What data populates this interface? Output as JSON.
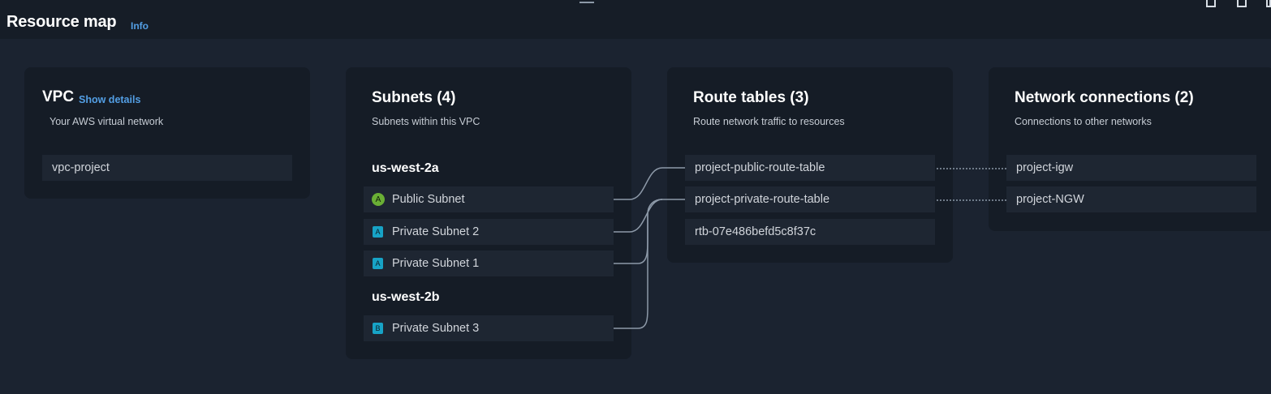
{
  "header": {
    "title": "Resource map",
    "info_label": "Info"
  },
  "vpc": {
    "title": "VPC",
    "show_details_label": "Show details",
    "subtitle": "Your AWS virtual network",
    "item": "vpc-project"
  },
  "subnets": {
    "title": "Subnets (4)",
    "subtitle": "Subnets within this VPC",
    "groups": [
      {
        "zone": "us-west-2a",
        "items": [
          {
            "label": "Public Subnet",
            "badge": "A",
            "badge_shape": "circle"
          },
          {
            "label": "Private Subnet 2",
            "badge": "A",
            "badge_shape": "square"
          },
          {
            "label": "Private Subnet 1",
            "badge": "A",
            "badge_shape": "square"
          }
        ]
      },
      {
        "zone": "us-west-2b",
        "items": [
          {
            "label": "Private Subnet 3",
            "badge": "B",
            "badge_shape": "square"
          }
        ]
      }
    ]
  },
  "route_tables": {
    "title": "Route tables (3)",
    "subtitle": "Route network traffic to resources",
    "items": [
      "project-public-route-table",
      "project-private-route-table",
      "rtb-07e486befd5c8f37c"
    ]
  },
  "network_connections": {
    "title": "Network connections (2)",
    "subtitle": "Connections to other networks",
    "items": [
      "project-igw",
      "project-NGW"
    ]
  },
  "colors": {
    "background": "#1b2330",
    "panel": "#151c26",
    "row": "#1e2632",
    "link": "#539fe5",
    "public_badge": "#6aaf35",
    "private_badge": "#17a3c6",
    "connector": "#8d99a8"
  }
}
